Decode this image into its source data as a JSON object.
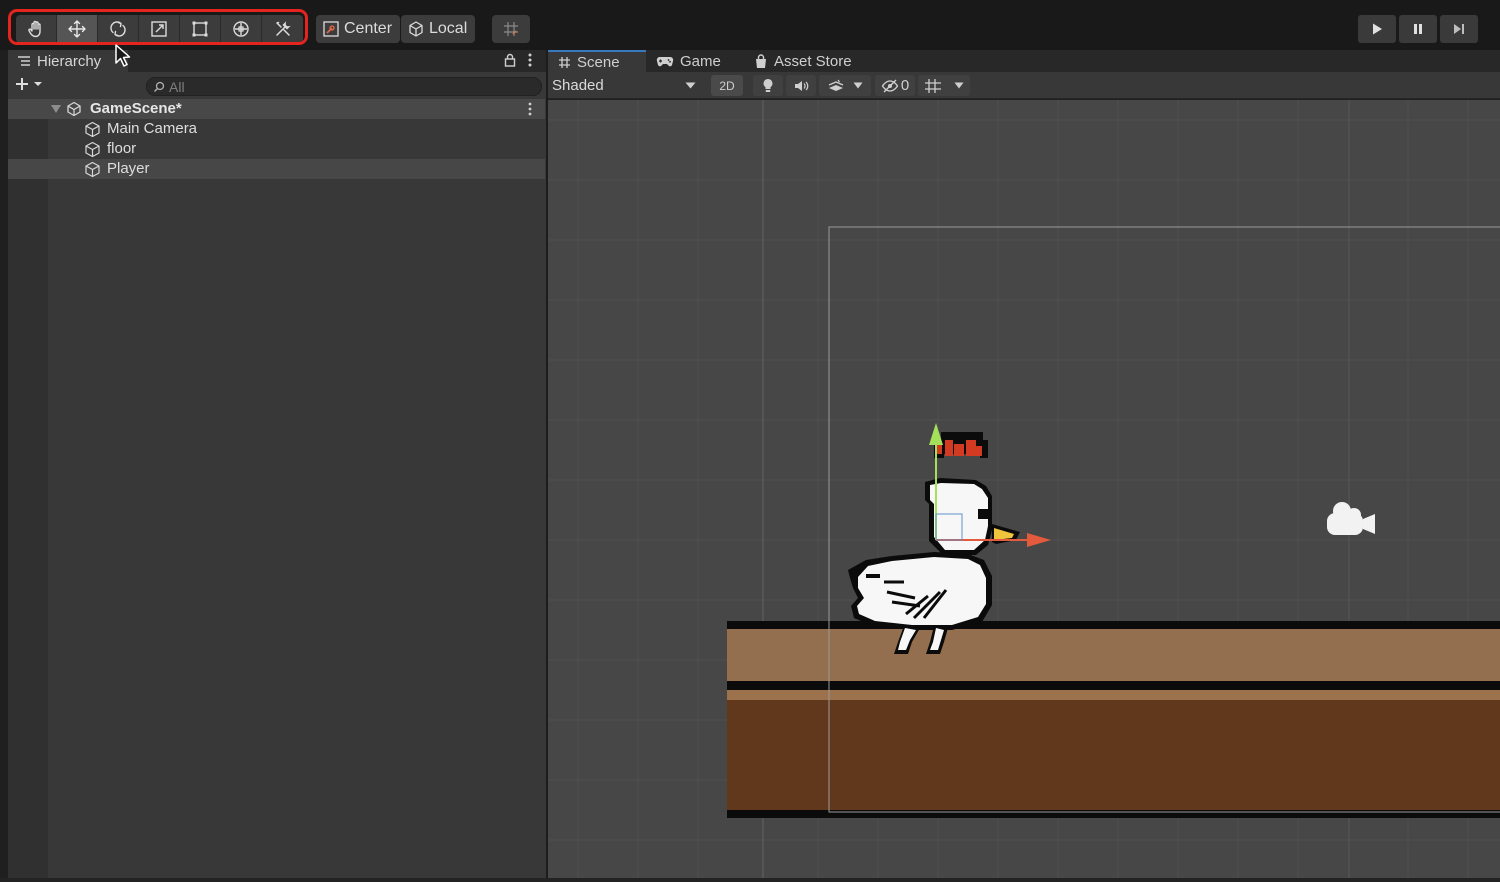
{
  "toolbar": {
    "tools": [
      {
        "name": "hand-tool",
        "icon": "hand-icon"
      },
      {
        "name": "move-tool",
        "icon": "move-arrows-icon",
        "active": true
      },
      {
        "name": "rotate-tool",
        "icon": "rotate-icon"
      },
      {
        "name": "scale-tool",
        "icon": "scale-icon"
      },
      {
        "name": "rect-tool",
        "icon": "rect-transform-icon"
      },
      {
        "name": "transform-tool",
        "icon": "transform-icon"
      },
      {
        "name": "custom-tool",
        "icon": "custom-tools-icon"
      }
    ],
    "pivot_mode_label": "Center",
    "pivot_rotation_label": "Local",
    "snap_icon": "grid-snap-icon",
    "highlight_color": "#e3241f"
  },
  "play_controls": [
    "play-icon",
    "pause-icon",
    "step-icon"
  ],
  "hierarchy": {
    "title": "Hierarchy",
    "search_placeholder": "All",
    "scene_name": "GameScene*",
    "items": [
      {
        "label": "Main Camera",
        "icon": "gameobject-cube-icon"
      },
      {
        "label": "floor",
        "icon": "gameobject-cube-icon"
      },
      {
        "label": "Player",
        "icon": "gameobject-cube-icon",
        "selected": true
      }
    ]
  },
  "scene_view": {
    "tabs": [
      {
        "label": "Scene",
        "icon": "grid-icon",
        "active": true
      },
      {
        "label": "Game",
        "icon": "gamepad-icon"
      },
      {
        "label": "Asset Store",
        "icon": "shopping-bag-icon"
      }
    ],
    "shading_mode": "Shaded",
    "mode_2d_label": "2D",
    "hidden_count": "0",
    "colors": {
      "background": "#474747",
      "floor_top": "#936f4f",
      "floor_bottom": "#61381c",
      "gizmo_y": "#a5e05a",
      "gizmo_x": "#e35a3c",
      "crown": "#d33a22",
      "beak": "#f0c43c"
    }
  }
}
